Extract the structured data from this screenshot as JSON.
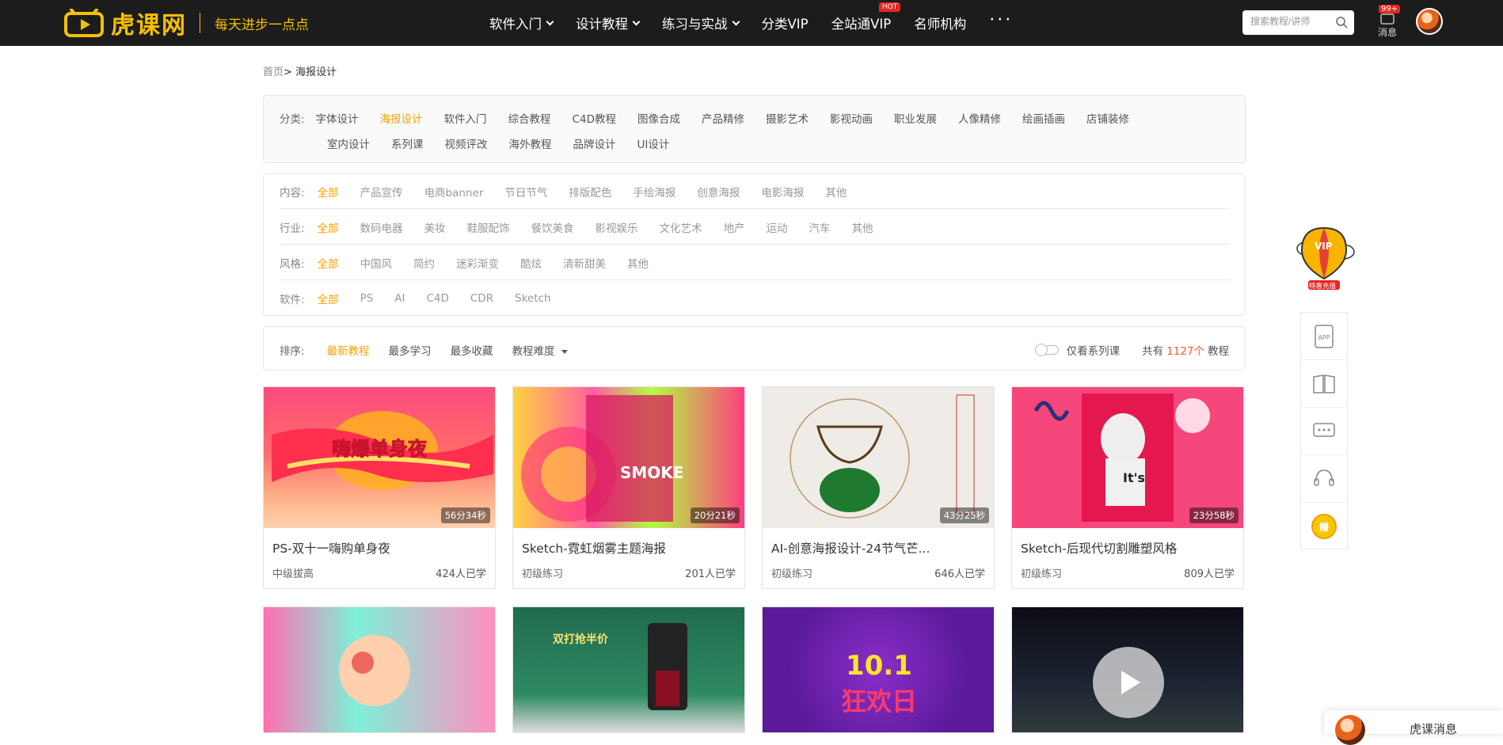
{
  "header": {
    "logo_text": "虎课网",
    "slogan": "每天进步一点点",
    "nav": [
      {
        "label": "软件入门",
        "caret": true
      },
      {
        "label": "设计教程",
        "caret": true
      },
      {
        "label": "练习与实战",
        "caret": true
      },
      {
        "label": "分类VIP",
        "caret": false
      },
      {
        "label": "全站通VIP",
        "caret": false,
        "badge": "HOT"
      },
      {
        "label": "名师机构",
        "caret": false
      }
    ],
    "more": "···",
    "search_placeholder": "搜索教程/讲师",
    "messages_label": "消息",
    "messages_badge": "99+"
  },
  "breadcrumb": {
    "home": "首页",
    "sep": ">",
    "current": "海报设计"
  },
  "category": {
    "label": "分类:",
    "row1": [
      "字体设计",
      "海报设计",
      "软件入门",
      "综合教程",
      "C4D教程",
      "图像合成",
      "产品精修",
      "摄影艺术",
      "影视动画",
      "职业发展",
      "人像精修",
      "绘画插画",
      "店铺装修"
    ],
    "row2": [
      "室内设计",
      "系列课",
      "视频评改",
      "海外教程",
      "品牌设计",
      "UI设计"
    ],
    "selected": "海报设计"
  },
  "filters": [
    {
      "label": "内容:",
      "options": [
        "全部",
        "产品宣传",
        "电商banner",
        "节日节气",
        "排版配色",
        "手绘海报",
        "创意海报",
        "电影海报",
        "其他"
      ]
    },
    {
      "label": "行业:",
      "options": [
        "全部",
        "数码电器",
        "美妆",
        "鞋服配饰",
        "餐饮美食",
        "影视娱乐",
        "文化艺术",
        "地产",
        "运动",
        "汽车",
        "其他"
      ]
    },
    {
      "label": "风格:",
      "options": [
        "全部",
        "中国风",
        "简约",
        "迷彩渐变",
        "酷炫",
        "清新甜美",
        "其他"
      ]
    },
    {
      "label": "软件:",
      "options": [
        "全部",
        "PS",
        "AI",
        "C4D",
        "CDR",
        "Sketch"
      ]
    }
  ],
  "sort": {
    "label": "排序:",
    "options": [
      "最新教程",
      "最多学习",
      "最多收藏"
    ],
    "difficulty": "教程难度",
    "series_only": "仅看系列课",
    "total_prefix": "共有",
    "total_count": "1127个",
    "total_suffix": "教程"
  },
  "courses": [
    {
      "title": "PS-双十一嗨购单身夜",
      "duration": "56分34秒",
      "level": "中级拔高",
      "learners": "424人已学"
    },
    {
      "title": "Sketch-霓虹烟雾主题海报",
      "duration": "20分21秒",
      "level": "初级练习",
      "learners": "201人已学"
    },
    {
      "title": "AI-创意海报设计-24节气芒...",
      "duration": "43分25秒",
      "level": "初级练习",
      "learners": "646人已学"
    },
    {
      "title": "Sketch-后现代切割雕塑风格",
      "duration": "23分58秒",
      "level": "初级练习",
      "learners": "809人已学"
    }
  ],
  "side": {
    "app_label": "APP",
    "earn_label": "赚",
    "vip_label": "VIP",
    "vip_sub": "特惠充值"
  },
  "float_msg": {
    "text": "虎课消息"
  },
  "colors": {
    "accent": "#f7a100",
    "header_bg": "#1c1c1c",
    "logo": "#f5c000",
    "count": "#f35a2b"
  }
}
